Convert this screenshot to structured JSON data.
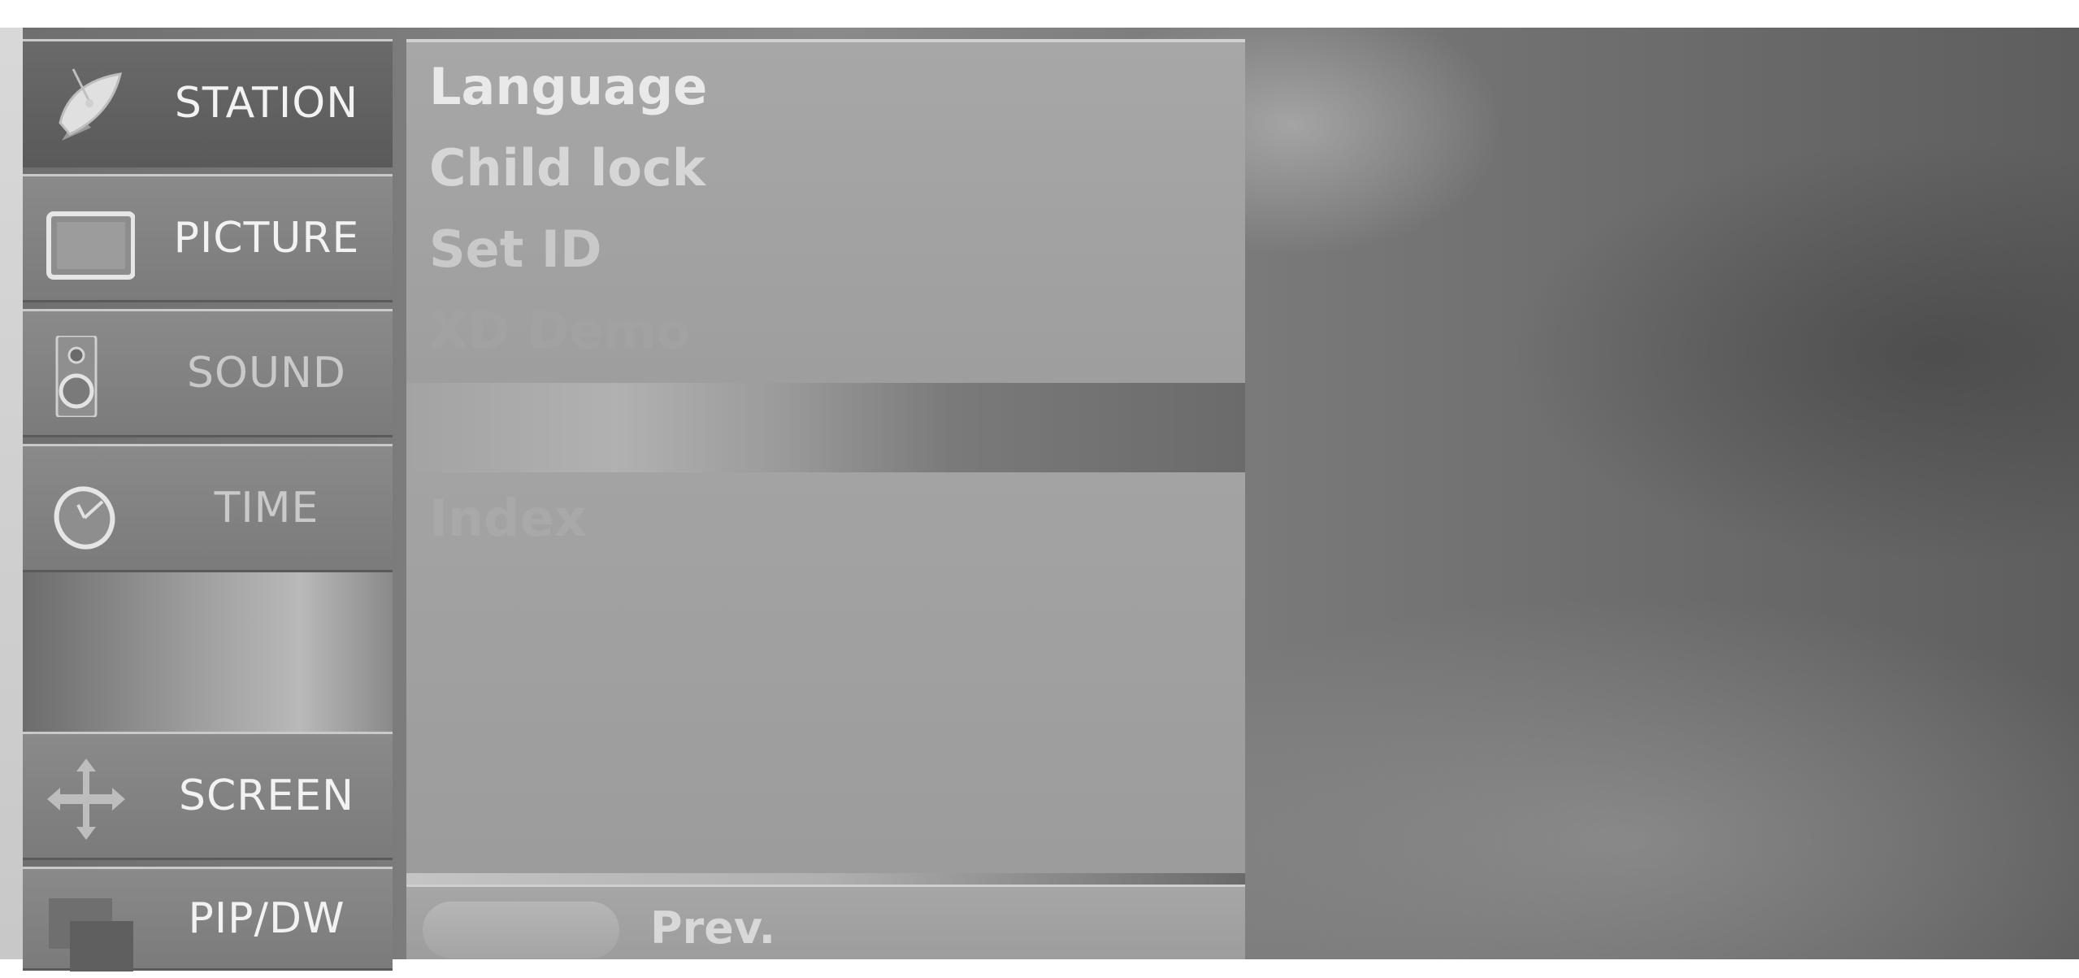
{
  "sidebar": {
    "items": [
      {
        "label": "STATION",
        "icon": "satellite-dish-icon",
        "active": true
      },
      {
        "label": "PICTURE",
        "icon": "tv-screen-icon"
      },
      {
        "label": "SOUND",
        "icon": "speaker-icon"
      },
      {
        "label": "TIME",
        "icon": "clock-icon"
      },
      {
        "label": "SCREEN",
        "icon": "move-arrows-icon"
      },
      {
        "label": "PIP/DW",
        "icon": "pip-windows-icon"
      }
    ]
  },
  "submenu": {
    "items": [
      {
        "label": "Language"
      },
      {
        "label": "Child lock"
      },
      {
        "label": "Set ID"
      },
      {
        "label": "XD Demo"
      }
    ],
    "lower_item": "Index"
  },
  "footer": {
    "prev_label": "Prev."
  }
}
